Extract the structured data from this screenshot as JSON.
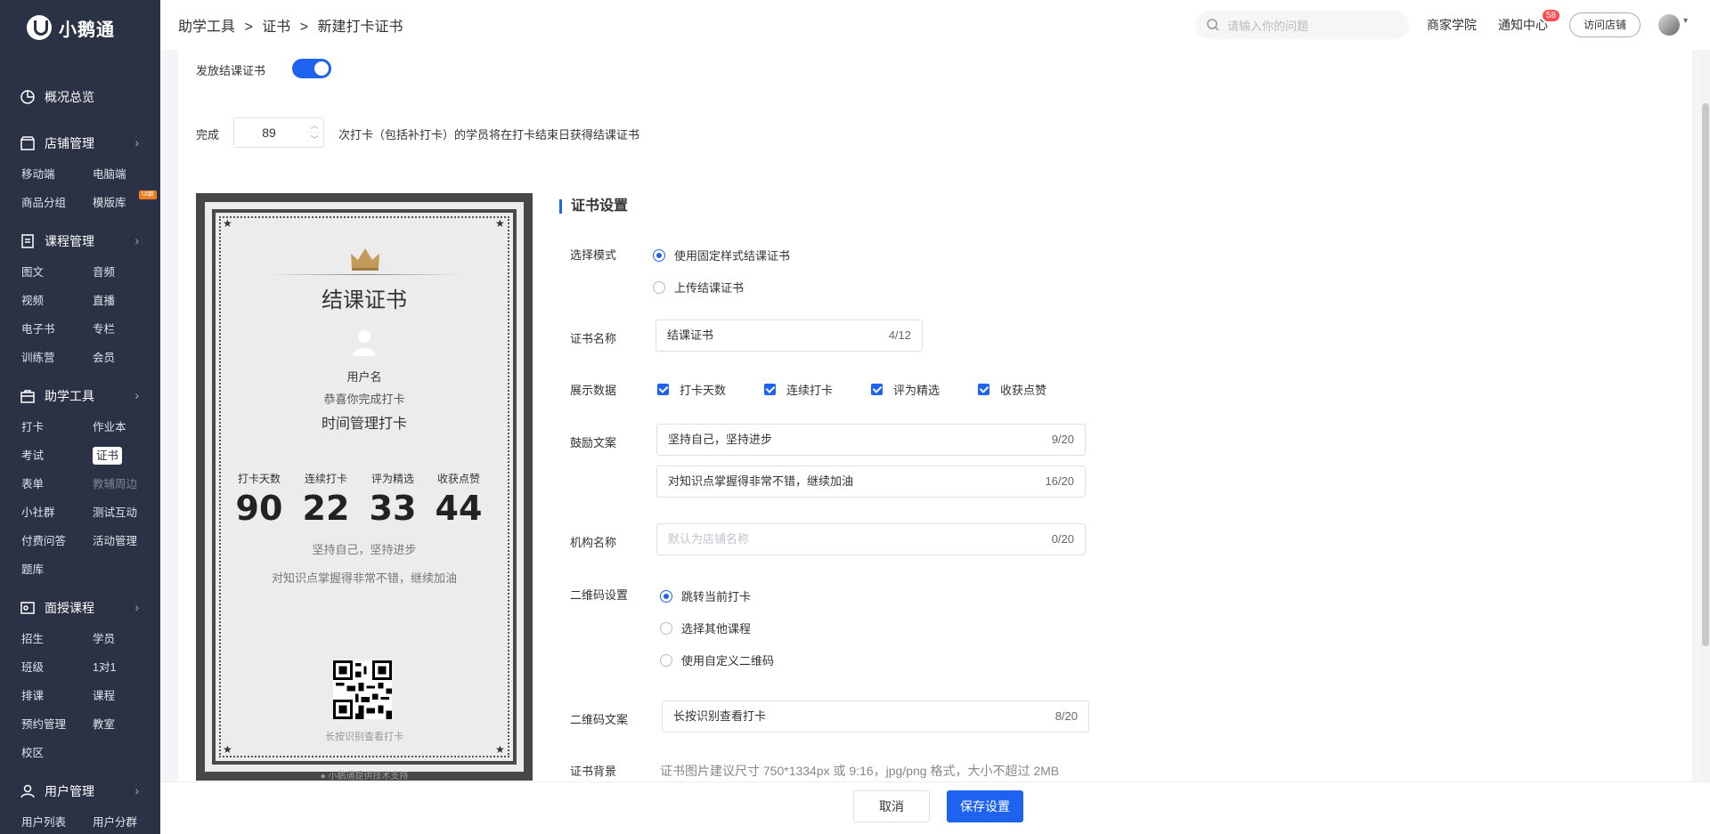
{
  "app": {
    "name": "小鹅通"
  },
  "sidebar": {
    "groups": [
      {
        "label": "概况总览",
        "icon": "pie-chart-icon",
        "items": []
      },
      {
        "label": "店铺管理",
        "icon": "shop-icon",
        "items": [
          "移动端",
          "电脑端",
          "商品分组",
          "模版库"
        ]
      },
      {
        "label": "课程管理",
        "icon": "document-icon",
        "items": [
          "图文",
          "音频",
          "视频",
          "直播",
          "电子书",
          "专栏",
          "训练营",
          "会员"
        ]
      },
      {
        "label": "助学工具",
        "icon": "toolbox-icon",
        "items": [
          "打卡",
          "作业本",
          "考试",
          "证书",
          "表单",
          "教辅周边",
          "小社群",
          "测试互动",
          "付费问答",
          "活动管理",
          "题库"
        ]
      },
      {
        "label": "面授课程",
        "icon": "classroom-icon",
        "items": [
          "招生",
          "学员",
          "班级",
          "1对1",
          "排课",
          "课程",
          "预约管理",
          "教室",
          "校区"
        ]
      },
      {
        "label": "用户管理",
        "icon": "user-icon",
        "items": [
          "用户列表",
          "用户分群"
        ]
      }
    ],
    "new_tag": "UI新",
    "active_item": "证书"
  },
  "header": {
    "breadcrumb": [
      "助学工具",
      ">",
      "证书",
      ">",
      "新建打卡证书"
    ],
    "search_placeholder": "请输入你的问题",
    "links": {
      "academy": "商家学院",
      "notify": "通知中心",
      "notify_badge": "58",
      "visit": "访问店铺"
    }
  },
  "form": {
    "issue_label": "发放结课证书",
    "issue_enabled": true,
    "complete_prefix": "完成",
    "complete_value": "89",
    "complete_suffix": "次打卡（包括补打卡）的学员将在打卡结束日获得结课证书",
    "section_title": "证书设置",
    "mode_label": "选择模式",
    "mode_options": [
      "使用固定样式结课证书",
      "上传结课证书"
    ],
    "name_label": "证书名称",
    "name_value": "结课证书",
    "name_count": "4/12",
    "data_label": "展示数据",
    "data_options": [
      "打卡天数",
      "连续打卡",
      "评为精选",
      "收获点赞"
    ],
    "encourage_label": "鼓励文案",
    "encourage_1": "坚持自己，坚持进步",
    "encourage_1_count": "9/20",
    "encourage_2": "对知识点掌握得非常不错，继续加油",
    "encourage_2_count": "16/20",
    "org_label": "机构名称",
    "org_placeholder": "默认为店铺名称",
    "org_count": "0/20",
    "qr_label": "二维码设置",
    "qr_options": [
      "跳转当前打卡",
      "选择其他课程",
      "使用自定义二维码"
    ],
    "qr_text_label": "二维码文案",
    "qr_text_value": "长按识别查看打卡",
    "qr_text_count": "8/20",
    "bg_label": "证书背景",
    "bg_hint": "证书图片建议尺寸 750*1334px 或 9:16，jpg/png 格式，大小不超过 2MB"
  },
  "certificate": {
    "title": "结课证书",
    "username": "用户名",
    "congrats": "恭喜你完成打卡",
    "course": "时间管理打卡",
    "stats": [
      {
        "label": "打卡天数",
        "value": "90"
      },
      {
        "label": "连续打卡",
        "value": "22"
      },
      {
        "label": "评为精选",
        "value": "33"
      },
      {
        "label": "收获点赞",
        "value": "44"
      }
    ],
    "line1": "坚持自己，坚持进步",
    "line2": "对知识点掌握得非常不错，继续加油",
    "qr_caption": "长按识别查看打卡",
    "footer": "小鹅通提供技术支持"
  },
  "footer": {
    "cancel": "取消",
    "save": "保存设置"
  },
  "colors": {
    "sidebar": "#2b3245",
    "accent": "#1e63f0"
  }
}
